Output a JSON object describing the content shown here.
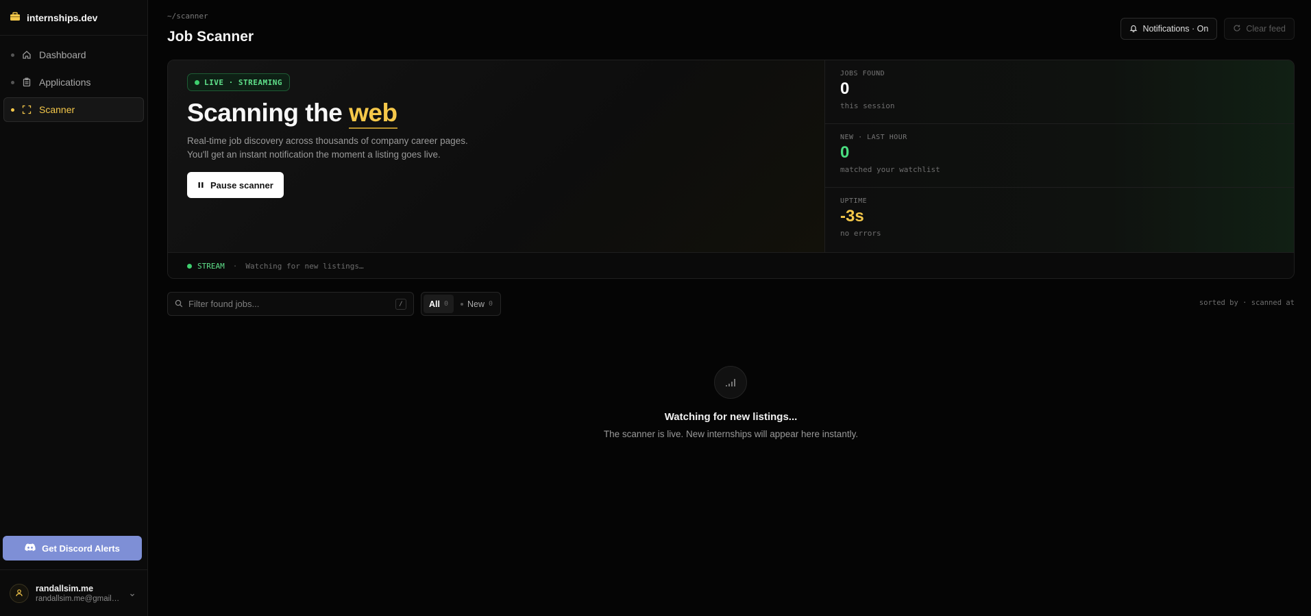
{
  "brand": {
    "name": "internships.dev"
  },
  "sidebar": {
    "items": [
      {
        "label": "Dashboard",
        "icon": "home-icon"
      },
      {
        "label": "Applications",
        "icon": "clipboard-icon"
      },
      {
        "label": "Scanner",
        "icon": "scan-icon",
        "active": true
      }
    ],
    "discord_label": "Get Discord Alerts"
  },
  "user": {
    "name": "randallsim.me",
    "email": "randallsim.me@gmail.com"
  },
  "header": {
    "path": "~/scanner",
    "title": "Job Scanner",
    "notifications_label": "Notifications · On",
    "clear_label": "Clear feed"
  },
  "hero": {
    "badge": "LIVE · STREAMING",
    "title_prefix": "Scanning the",
    "title_accent": "web",
    "desc_line1": "Real-time job discovery across thousands of company career pages.",
    "desc_line2": "You'll get an instant notification the moment a listing goes live.",
    "pause_label": "Pause scanner"
  },
  "stats": [
    {
      "label": "JOBS FOUND",
      "value": "0",
      "sub": "this session",
      "color": "#ffffff"
    },
    {
      "label": "NEW · LAST HOUR",
      "value": "0",
      "sub": "matched your watchlist",
      "color": "#4ade80"
    },
    {
      "label": "UPTIME",
      "value": "-3s",
      "sub": "no errors",
      "color": "#f5c84a"
    }
  ],
  "stream": {
    "label": "STREAM",
    "sep": "·",
    "text": "Watching for new listings…"
  },
  "filter": {
    "placeholder": "Filter found jobs...",
    "shortcut": "/",
    "tabs": [
      {
        "label": "All",
        "count": "0"
      },
      {
        "label": "New",
        "count": "0"
      }
    ],
    "sorted_text": "sorted by · scanned at"
  },
  "empty": {
    "title": "Watching for new listings...",
    "subtitle": "The scanner is live. New internships will appear here instantly."
  },
  "colors": {
    "accent": "#f5c84a",
    "live": "#3ecf6e",
    "discord": "#7e8fd6"
  }
}
